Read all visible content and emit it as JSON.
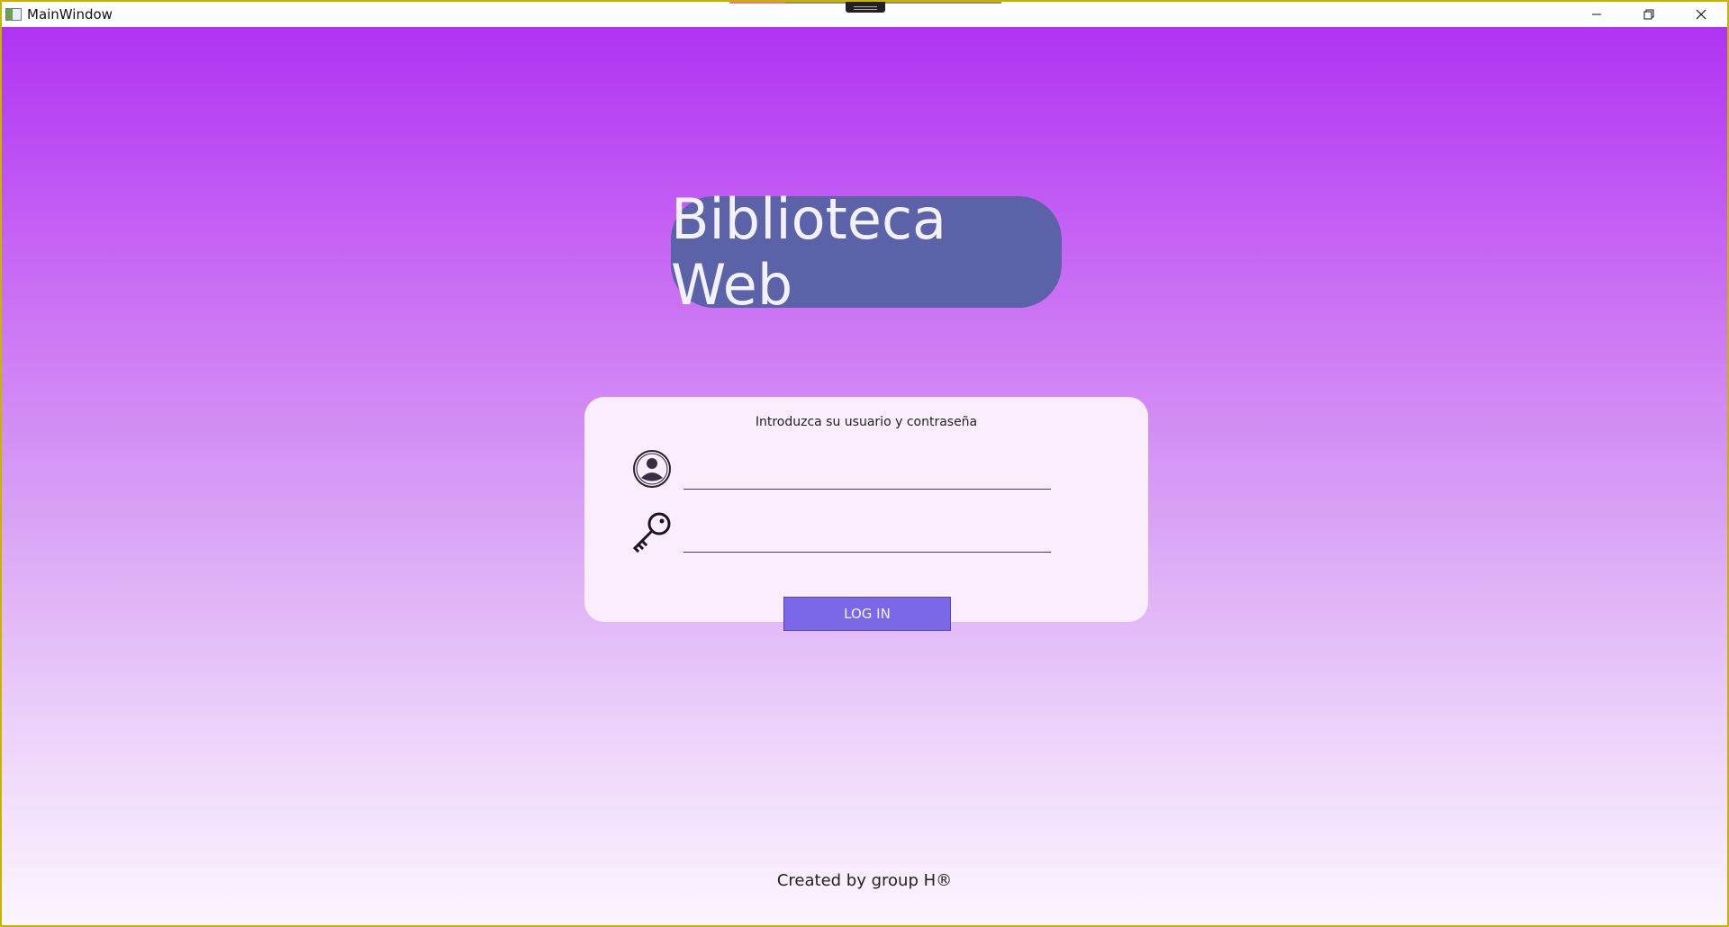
{
  "window": {
    "title": "MainWindow",
    "controls": {
      "minimize": "—",
      "restore": "❐",
      "close": "✕"
    }
  },
  "app": {
    "heading": "Biblioteca Web",
    "login": {
      "instruction": "Introduzca su usuario y contraseña",
      "username": {
        "value": "",
        "icon": "user-icon"
      },
      "password": {
        "value": "",
        "icon": "key-icon"
      },
      "button_label": "LOG IN"
    },
    "footer": "Created by group H®"
  },
  "colors": {
    "gradient_top": "#b033f2",
    "gradient_bottom": "#fcf6fe",
    "heading_pill": "#5b62a8",
    "card_bg": "#faeefc",
    "button_bg": "#7b68e6"
  }
}
